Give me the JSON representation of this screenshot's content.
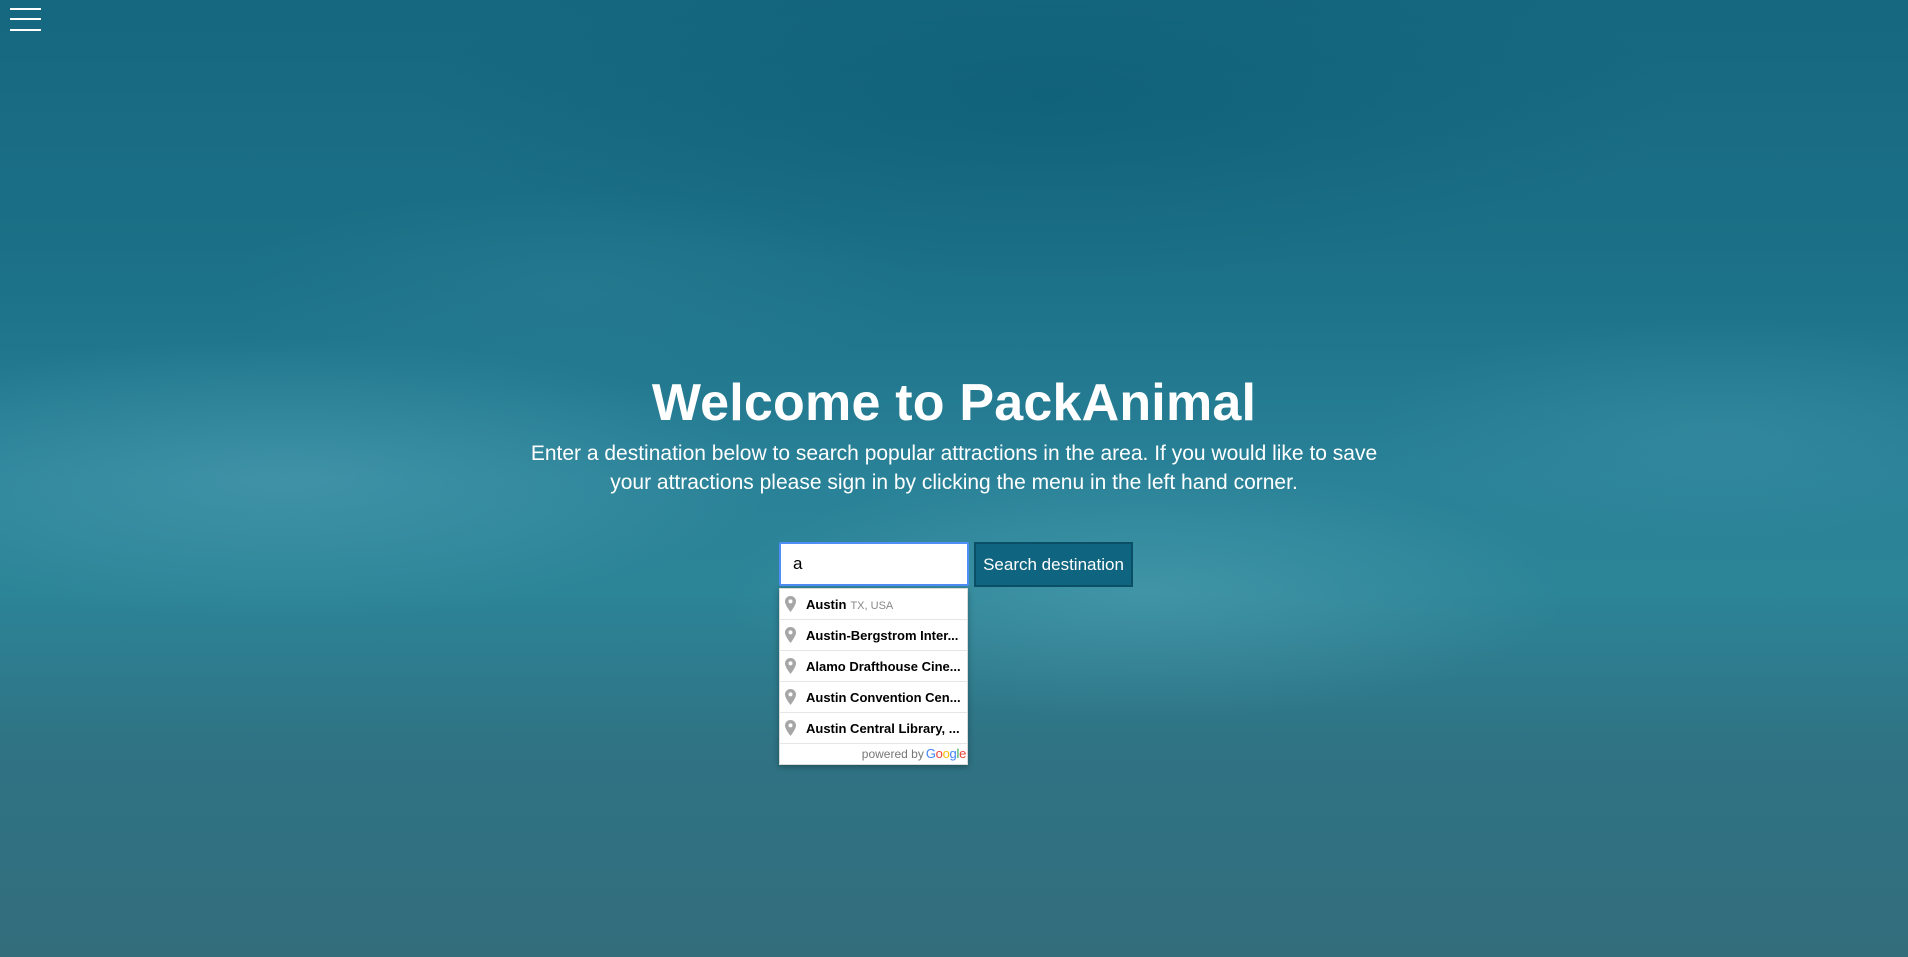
{
  "nav": {
    "menu_icon": "hamburger-menu-icon"
  },
  "hero": {
    "title": "Welcome to PackAnimal",
    "subtitle": "Enter a destination below to search popular attractions in the area. If you would like to save your attractions please sign in by clicking the menu in the left hand corner."
  },
  "search": {
    "value": "a",
    "button_label": "Search destination"
  },
  "autocomplete": {
    "items": [
      {
        "main": "Austin",
        "secondary": "TX, USA"
      },
      {
        "main": "Austin-Bergstrom Inter...",
        "secondary": ""
      },
      {
        "main": "Alamo Drafthouse Cine...",
        "secondary": ""
      },
      {
        "main": "Austin Convention Cen...",
        "secondary": ""
      },
      {
        "main": "Austin Central Library, ...",
        "secondary": ""
      }
    ],
    "pin_icon": "map-pin-icon",
    "footer_prefix": "powered by",
    "footer_brand": {
      "G": "G",
      "o1": "o",
      "o2": "o",
      "g": "g",
      "l": "l",
      "e": "e"
    }
  },
  "colors": {
    "accent_button": "#0f6480",
    "input_focus_border": "#4f8ef7",
    "background": "#1f6f80"
  }
}
